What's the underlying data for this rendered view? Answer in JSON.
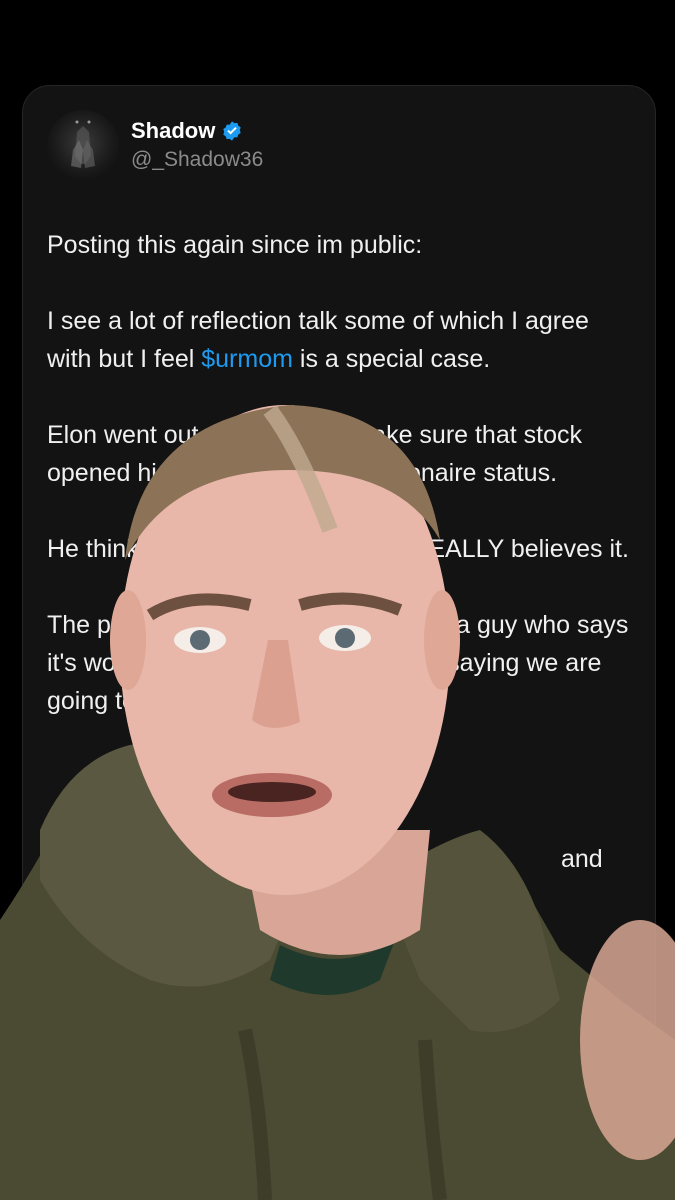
{
  "author": {
    "name": "Shadow",
    "handle": "@_Shadow36",
    "verified_icon": "verified-badge-icon",
    "avatar_icon": "praying-hands-icon"
  },
  "tweet": {
    "line1": "Posting this again since im public:",
    "p2_a": "I see a lot of reflection talk some of which I agree with but I feel ",
    "cashtag": "$urmom",
    "p2_b": " is a special case.",
    "p3": "Elon went out of his way to make sure that stock opened high to maintain that trillionaire status.",
    "p4": "He thinks it's going to moon, bro REALLY believes it.",
    "p5": "The pick I'm making is agreeing with a guy who says it's worth 10-30T(~2T currently). I'm saying we are going to see a minimum of 5x",
    "tail": "and"
  },
  "colors": {
    "background": "#000000",
    "card": "#131313",
    "text": "#f0f0f0",
    "muted": "#8b8b8b",
    "link": "#1d9bf0"
  }
}
